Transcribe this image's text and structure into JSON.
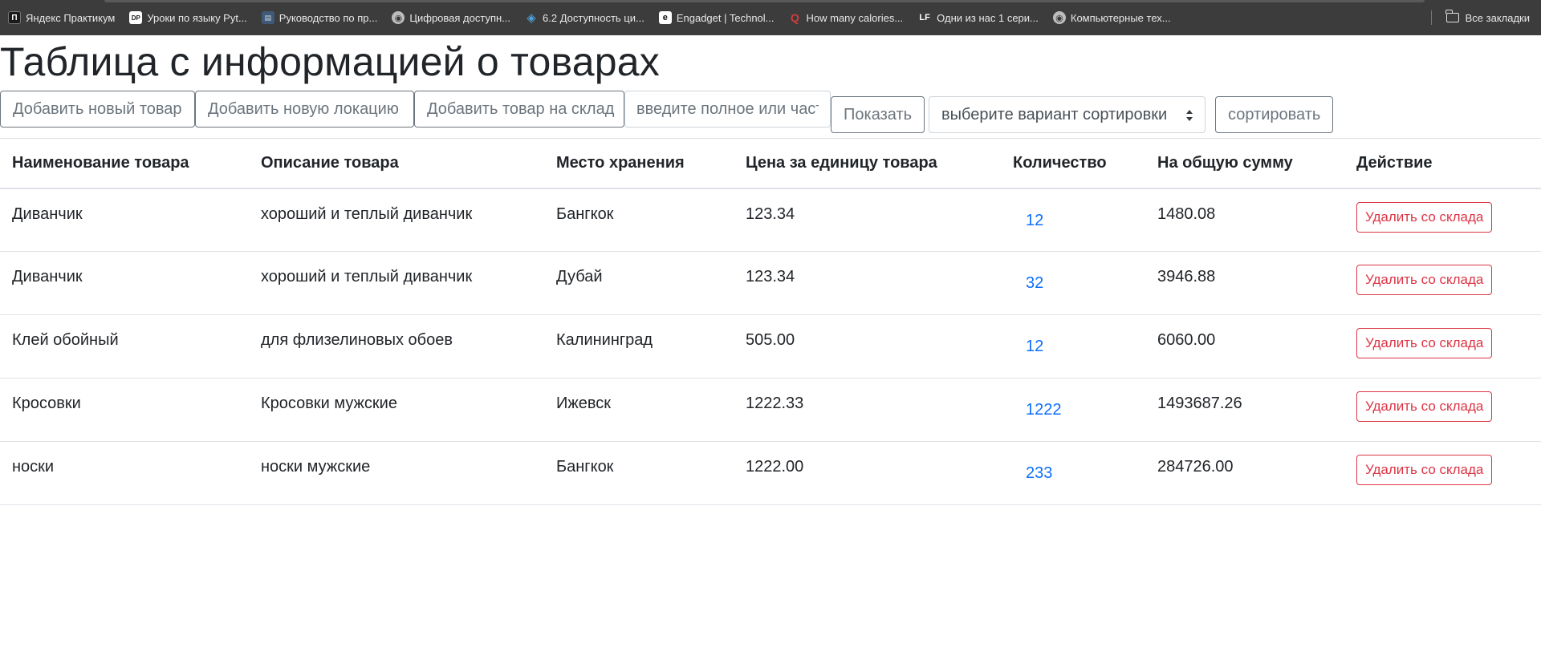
{
  "bookmarks": [
    {
      "icon": "yandex-practicum-icon",
      "glyph": "П",
      "label": "Яндекс Практикум"
    },
    {
      "icon": "dp-icon",
      "glyph": "DP",
      "label": "Уроки по языку Pyt..."
    },
    {
      "icon": "guide-icon",
      "glyph": "▤",
      "label": "Руководство по пр..."
    },
    {
      "icon": "globe-icon",
      "glyph": "◉",
      "label": "Цифровая доступн..."
    },
    {
      "icon": "diamond-icon",
      "glyph": "◈",
      "label": "6.2 Доступность ци..."
    },
    {
      "icon": "engadget-icon",
      "glyph": "e",
      "label": "Engadget | Technol..."
    },
    {
      "icon": "quora-icon",
      "glyph": "Q",
      "label": "How many calories..."
    },
    {
      "icon": "lf-icon",
      "glyph": "LF",
      "label": "Одни из нас 1 сери..."
    },
    {
      "icon": "globe-icon",
      "glyph": "◉",
      "label": "Компьютерные тех..."
    }
  ],
  "all_bookmarks_label": "Все закладки",
  "page_title": "Таблица с информацией о товарах",
  "toolbar": {
    "add_product": "Добавить новый товар",
    "add_location": "Добавить новую локацию",
    "add_to_stock": "Добавить товар на склад",
    "search_placeholder": "введите полное или частичное название",
    "show": "Показать",
    "sort_select": "выберите вариант сортировки",
    "sort": "сортировать"
  },
  "table": {
    "headers": [
      "Наименование товара",
      "Описание товара",
      "Место хранения",
      "Цена за единицу товара",
      "Количество",
      "На общую сумму",
      "Действие"
    ],
    "rows": [
      {
        "name": "Диванчик",
        "description": "хороший и теплый диванчик",
        "location": "Бангкок",
        "price": "123.34",
        "quantity": "12",
        "total": "1480.08",
        "action": "Удалить со склада"
      },
      {
        "name": "Диванчик",
        "description": "хороший и теплый диванчик",
        "location": "Дубай",
        "price": "123.34",
        "quantity": "32",
        "total": "3946.88",
        "action": "Удалить со склада"
      },
      {
        "name": "Клей обойный",
        "description": "для флизелиновых обоев",
        "location": "Калининград",
        "price": "505.00",
        "quantity": "12",
        "total": "6060.00",
        "action": "Удалить со склада"
      },
      {
        "name": "Кросовки",
        "description": "Кросовки мужские",
        "location": "Ижевск",
        "price": "1222.33",
        "quantity": "1222",
        "total": "1493687.26",
        "action": "Удалить со склада"
      },
      {
        "name": "носки",
        "description": "носки мужские",
        "location": "Бангкок",
        "price": "1222.00",
        "quantity": "233",
        "total": "284726.00",
        "action": "Удалить со склада"
      }
    ]
  },
  "colors": {
    "primary_link": "#0d6efd",
    "danger": "#dc3545",
    "secondary": "#6c757d",
    "bookmarks_bg": "#3c3c3c"
  }
}
